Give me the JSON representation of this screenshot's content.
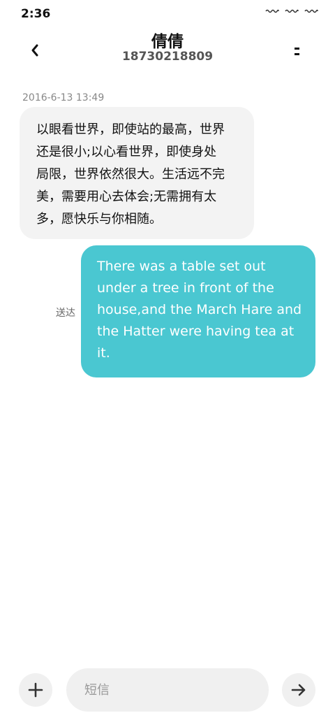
{
  "status_bar": {
    "time": "2:36"
  },
  "header": {
    "contact_name": "倩倩",
    "phone_number": "18730218809",
    "back_icon": "chevron-left-icon",
    "menu_icon": "more-icon"
  },
  "conversation": {
    "timestamp": "2016-6-13 13:49",
    "messages": [
      {
        "direction": "incoming",
        "lines": [
          "以眼看世界，即使站的最高，世界",
          "还是很小;以心看世界，即使身处",
          "局限，世界依然很大。生活远不完",
          "美，需要用心去体会;无需拥有太",
          "多，愿快乐与你相随。"
        ]
      },
      {
        "direction": "outgoing",
        "lines": [
          "There was a table set out",
          "under a tree in front of the",
          "house,and the March Hare and",
          "the Hatter were having tea at",
          "it."
        ],
        "status": "送达"
      }
    ]
  },
  "composer": {
    "placeholder": "短信",
    "value": "",
    "add_icon": "plus-icon",
    "send_icon": "arrow-right-icon"
  },
  "colors": {
    "outgoing_bubble": "#4ac7d1",
    "incoming_bubble": "#f3f3f3"
  }
}
